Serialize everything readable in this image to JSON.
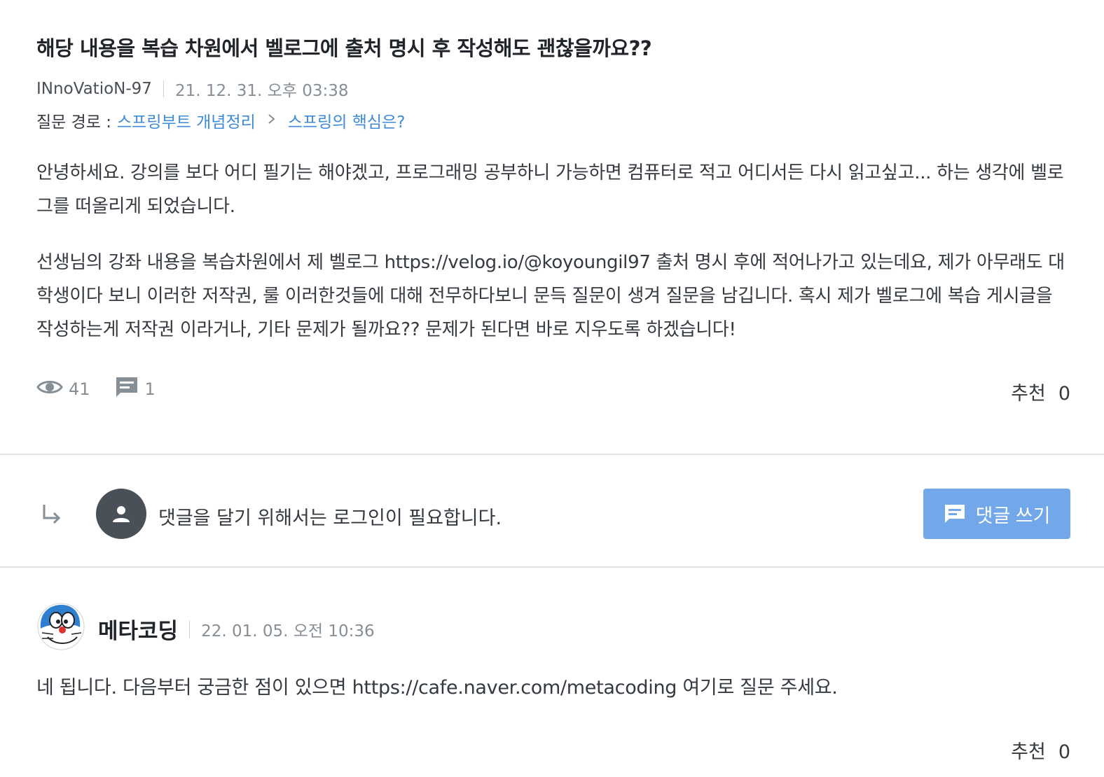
{
  "question": {
    "title": "해당 내용을 복습 차원에서 벨로그에 출처 명시 후 작성해도 괜찮을까요??",
    "author": "INnoVatioN-97",
    "date": "21. 12. 31. 오후 03:38",
    "route_label": "질문 경로 :",
    "route_course": "스프링부트 개념정리",
    "route_lecture": "스프링의 핵심은?",
    "paragraph1": "안녕하세요. 강의를 보다 어디 필기는 해야겠고, 프로그래밍 공부하니 가능하면 컴퓨터로 적고 어디서든 다시 읽고싶고... 하는 생각에 벨로그를 떠올리게 되었습니다.",
    "paragraph2": "선생님의 강좌 내용을 복습차원에서 제 벨로그 https://velog.io/@koyoungil97 출처 명시 후에 적어나가고 있는데요, 제가 아무래도 대학생이다 보니 이러한 저작권, 룰 이러한것들에 대해 전무하다보니 문득 질문이 생겨 질문을 남깁니다. 혹시 제가 벨로그에 복습 게시글을 작성하는게 저작권 이라거나, 기타 문제가 될까요?? 문제가 된다면 바로 지우도록 하겠습니다!",
    "views": "41",
    "comments": "1",
    "recommend_label": "추천",
    "recommend_count": "0"
  },
  "comment_box": {
    "login_message": "댓글을 달기 위해서는 로그인이 필요합니다.",
    "write_button_label": "댓글 쓰기"
  },
  "answer": {
    "author": "메타코딩",
    "date": "22. 01. 05. 오전 10:36",
    "text": "네 됩니다. 다음부터 궁금한 점이 있으면 https://cafe.naver.com/metacoding 여기로 질문 주세요.",
    "recommend_label": "추천",
    "recommend_count": "0"
  },
  "colors": {
    "link": "#3d8bd9",
    "button": "#72a8ea",
    "muted": "#868e96"
  }
}
